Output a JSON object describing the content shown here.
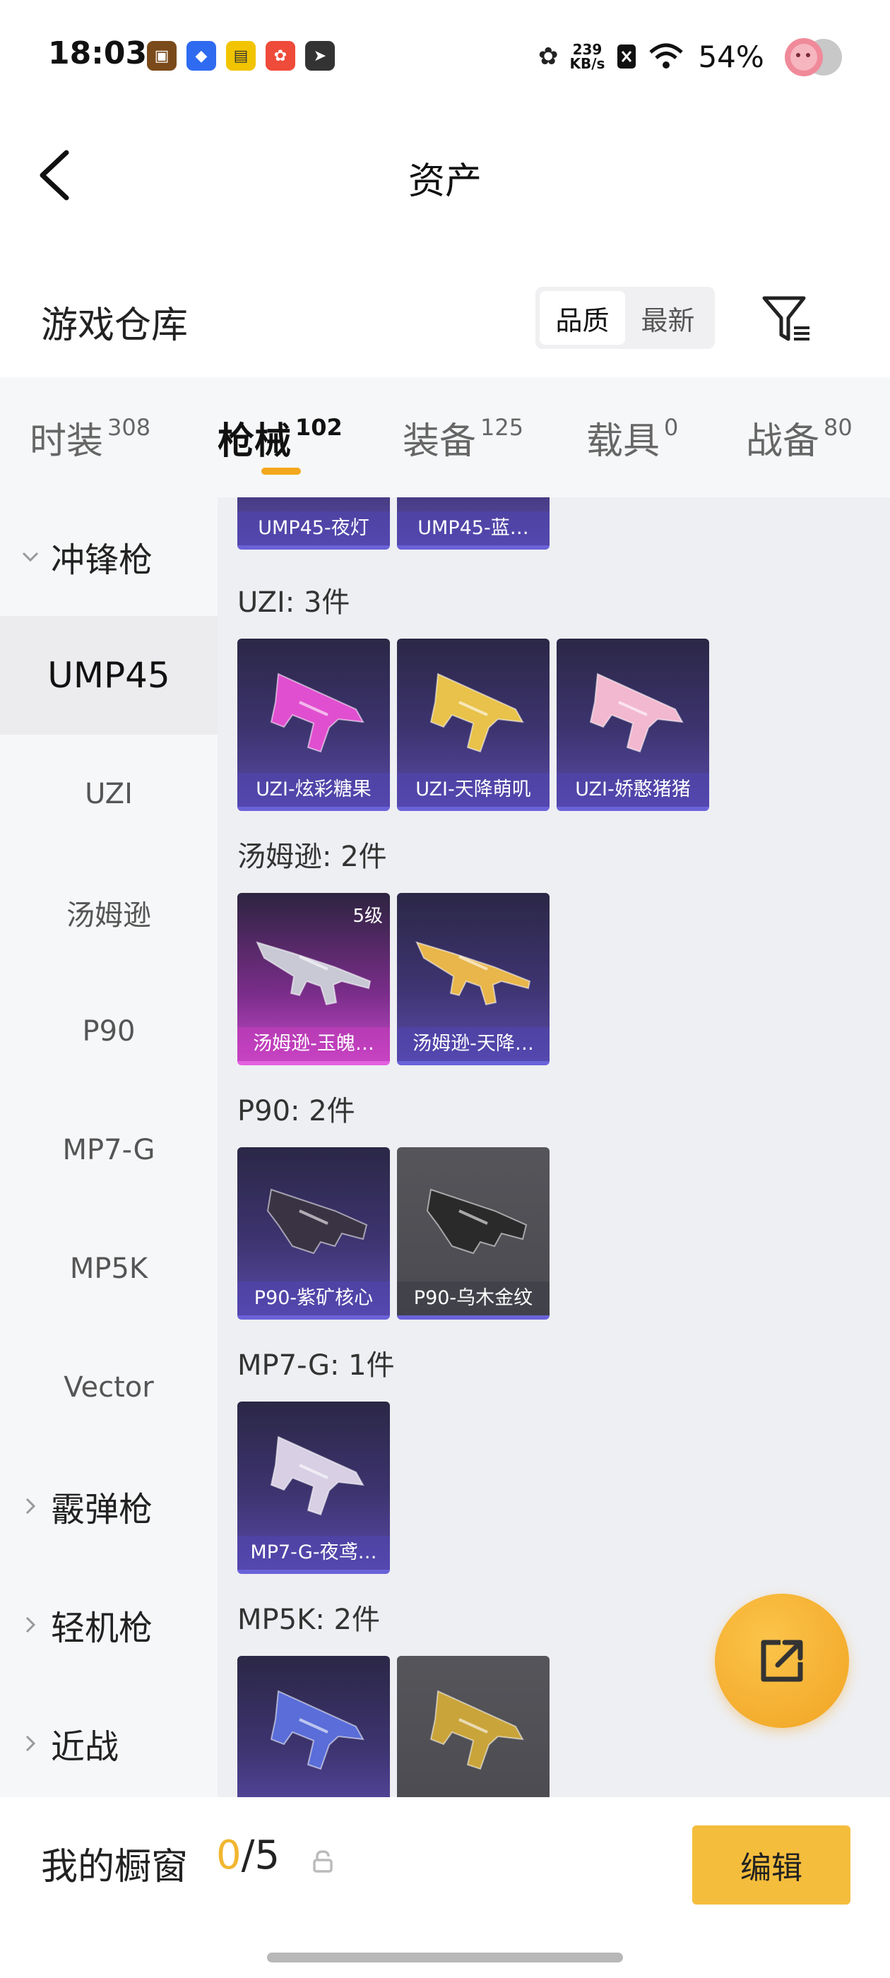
{
  "status_bar": {
    "time": "18:03",
    "net_speed_value": "239",
    "net_speed_unit": "KB/s",
    "battery": "54%",
    "notification_icons": [
      "game-app-icon",
      "blue-app-icon",
      "yellow-app-icon",
      "red-app-icon",
      "dark-app-icon"
    ]
  },
  "nav": {
    "title": "资产"
  },
  "header": {
    "section_title": "游戏仓库",
    "sort_options": [
      "品质",
      "最新"
    ],
    "active_sort": "品质"
  },
  "tabs": [
    {
      "label": "时装",
      "count": "308"
    },
    {
      "label": "枪械",
      "count": "102",
      "active": true
    },
    {
      "label": "装备",
      "count": "125"
    },
    {
      "label": "载具",
      "count": "0"
    },
    {
      "label": "战备",
      "count": "80"
    }
  ],
  "sidebar": {
    "items": [
      {
        "label": "冲锋枪",
        "type": "category",
        "expanded": true
      },
      {
        "label": "UMP45",
        "type": "sub",
        "selected": true
      },
      {
        "label": "UZI",
        "type": "sub"
      },
      {
        "label": "汤姆逊",
        "type": "sub"
      },
      {
        "label": "P90",
        "type": "sub"
      },
      {
        "label": "MP7-G",
        "type": "sub"
      },
      {
        "label": "MP5K",
        "type": "sub"
      },
      {
        "label": "Vector",
        "type": "sub"
      },
      {
        "label": "霰弹枪",
        "type": "category",
        "expanded": false
      },
      {
        "label": "轻机枪",
        "type": "category",
        "expanded": false
      },
      {
        "label": "近战",
        "type": "category",
        "expanded": false
      }
    ]
  },
  "content": {
    "partial_top": [
      {
        "name": "UMP45-夜灯"
      },
      {
        "name": "UMP45-蓝…"
      }
    ],
    "groups": [
      {
        "label": "UZI: 3件",
        "items": [
          {
            "name": "UZI-炫彩糖果",
            "style": "purple",
            "gun_color": "#e04fd0"
          },
          {
            "name": "UZI-天降萌叽",
            "style": "purple",
            "gun_color": "#e8c24a"
          },
          {
            "name": "UZI-娇憨猪猪",
            "style": "purple",
            "gun_color": "#f2b8cf"
          }
        ]
      },
      {
        "label": "汤姆逊: 2件",
        "items": [
          {
            "name": "汤姆逊-玉魄…",
            "style": "pink",
            "level": "5级",
            "gun_color": "#c9c9d6"
          },
          {
            "name": "汤姆逊-天降…",
            "style": "purple",
            "gun_color": "#e8b64a"
          }
        ]
      },
      {
        "label": "P90: 2件",
        "items": [
          {
            "name": "P90-紫矿核心",
            "style": "purple",
            "gun_color": "#3a3344"
          },
          {
            "name": "P90-乌木金纹",
            "style": "gray",
            "gun_color": "#2a2a2a"
          }
        ]
      },
      {
        "label": "MP7-G: 1件",
        "items": [
          {
            "name": "MP7-G-夜鸢…",
            "style": "purple",
            "gun_color": "#d8cfe4"
          }
        ]
      },
      {
        "label": "MP5K: 2件",
        "items": [
          {
            "name": "",
            "style": "purple",
            "gun_color": "#5a6dd8"
          },
          {
            "name": "",
            "style": "gray",
            "gun_color": "#c9a43a"
          }
        ]
      }
    ]
  },
  "bottom_bar": {
    "label": "我的橱窗",
    "used": "0",
    "total": "/5",
    "edit_label": "编辑"
  },
  "colors": {
    "accent": "#f2a81d",
    "edit_button": "#f5bd3c",
    "card_purple": "#3d3470",
    "card_pink": "#c54ac8",
    "card_gray": "#4a4a50"
  }
}
